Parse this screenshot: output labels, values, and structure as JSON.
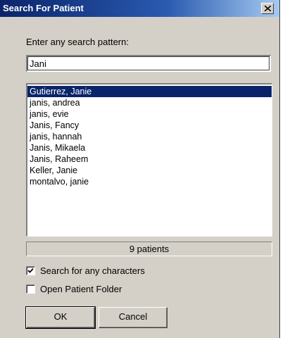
{
  "window": {
    "title": "Search For Patient",
    "close_glyph": "close-icon"
  },
  "search": {
    "label": "Enter any search pattern:",
    "value": "Jani"
  },
  "results": {
    "items": [
      "Gutierrez, Janie",
      "janis, andrea",
      "janis, evie",
      "Janis, Fancy",
      "janis, hannah",
      "Janis, Mikaela",
      "Janis, Raheem",
      "Keller, Janie",
      "montalvo, janie"
    ],
    "selected_index": 0,
    "count_text": "9 patients"
  },
  "options": {
    "any_characters": {
      "label": "Search for any characters",
      "checked": true
    },
    "open_folder": {
      "label": "Open Patient Folder",
      "checked": false
    }
  },
  "buttons": {
    "ok_label": "OK",
    "cancel_label": "Cancel"
  },
  "colors": {
    "title_bar": "#0a246a",
    "selection": "#0a246a",
    "dialog_bg": "#d4d0c8"
  }
}
